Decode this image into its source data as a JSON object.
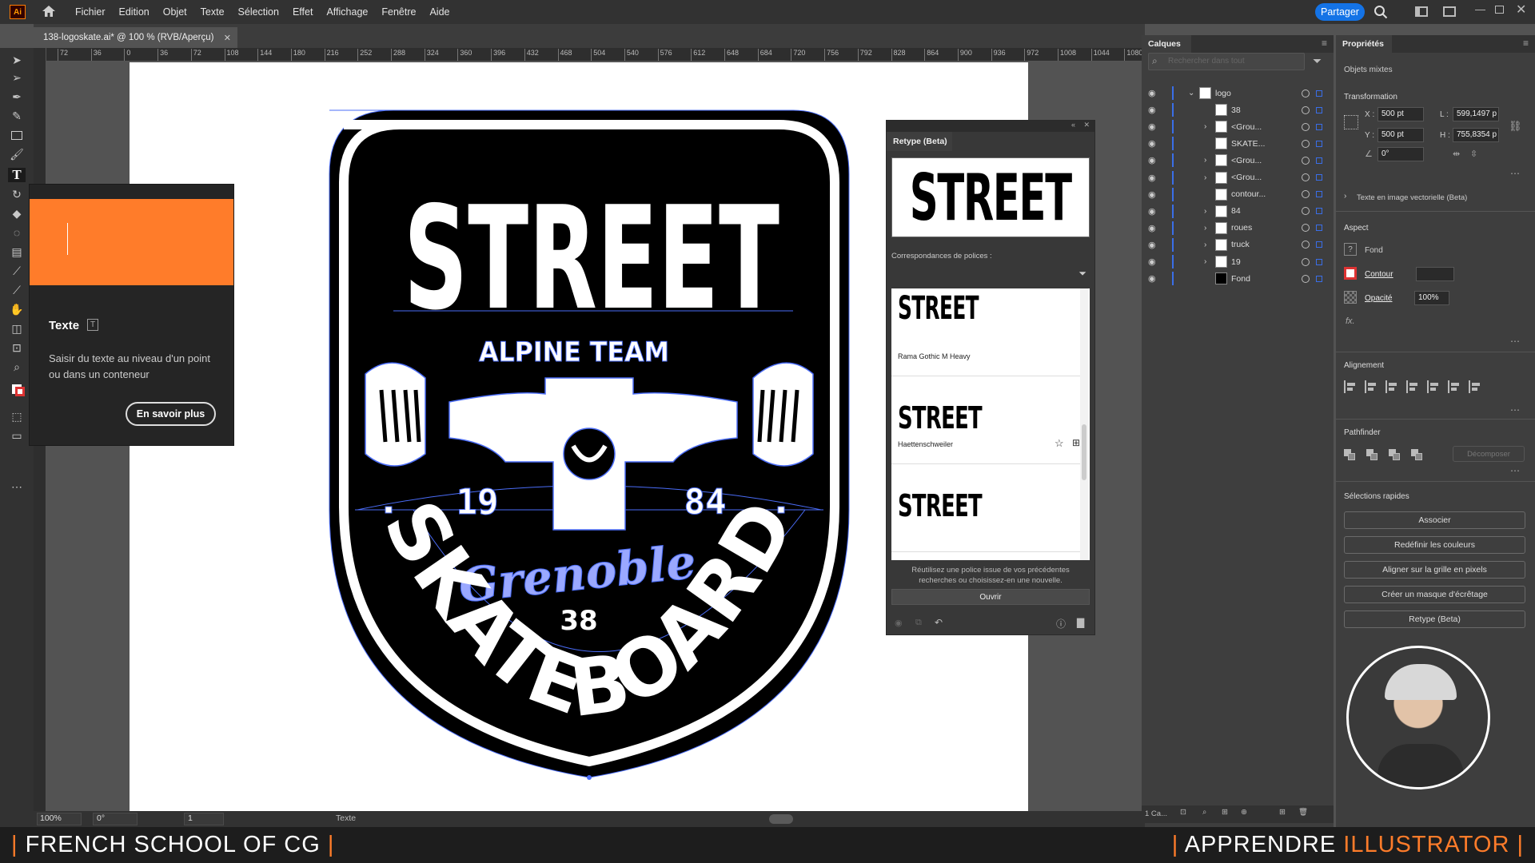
{
  "app": {
    "logo_text": "Ai",
    "share_label": "Partager"
  },
  "menu": [
    "Fichier",
    "Edition",
    "Objet",
    "Texte",
    "Sélection",
    "Effet",
    "Affichage",
    "Fenêtre",
    "Aide"
  ],
  "document": {
    "tab_title": "138-logoskate.ai* @ 100 % (RVB/Aperçu)"
  },
  "ruler": {
    "ticks": [
      "72",
      "36",
      "0",
      "36",
      "72",
      "108",
      "144",
      "180",
      "216",
      "252",
      "288",
      "324",
      "360",
      "396",
      "432",
      "468",
      "504",
      "540",
      "576",
      "612",
      "648",
      "684",
      "720",
      "756",
      "792",
      "828",
      "864",
      "900",
      "936",
      "972",
      "1008",
      "1044",
      "1080"
    ]
  },
  "tooltip": {
    "title": "Texte",
    "shortcut": "T",
    "description": "Saisir du texte au niveau d'un point ou dans un conteneur",
    "learn_more": "En savoir plus"
  },
  "artwork": {
    "title": "STREET",
    "subtitle": "ALPINE TEAM",
    "year_left": "19",
    "year_right": "84",
    "city": "Grenoble",
    "dept": "38",
    "bottom": "SKATEBOARD"
  },
  "retype": {
    "title": "Retype (Beta)",
    "preview_text": "STREET",
    "matches_label": "Correspondances de polices :",
    "fonts": [
      {
        "sample": "STREET",
        "name": ""
      },
      {
        "sample": "STREET",
        "name": "Rama Gothic M Heavy"
      },
      {
        "sample": "STREET",
        "name": "Haettenschweiler"
      }
    ],
    "help_text": "Réutilisez une police issue de vos précédentes recherches ou choisissez-en une nouvelle.",
    "open_button": "Ouvrir"
  },
  "layers": {
    "tab": "Calques",
    "search_placeholder": "Rechercher dans tout",
    "items": [
      {
        "name": "logo",
        "expandable": true,
        "top": true
      },
      {
        "name": "38",
        "expandable": false
      },
      {
        "name": "<Grou...",
        "expandable": true
      },
      {
        "name": "SKATE...",
        "expandable": false
      },
      {
        "name": "<Grou...",
        "expandable": true
      },
      {
        "name": "<Grou...",
        "expandable": true
      },
      {
        "name": "contour...",
        "expandable": false
      },
      {
        "name": "84",
        "expandable": true
      },
      {
        "name": "roues",
        "expandable": true
      },
      {
        "name": "truck",
        "expandable": true
      },
      {
        "name": "19",
        "expandable": true
      },
      {
        "name": "Fond",
        "expandable": false
      }
    ],
    "footer_count": "1 Ca..."
  },
  "properties": {
    "tab": "Propriétés",
    "selection_type": "Objets mixtes",
    "transform_title": "Transformation",
    "x_label": "X :",
    "x_value": "500 pt",
    "y_label": "Y :",
    "y_value": "500 pt",
    "w_label": "L :",
    "w_value": "599,1497 p",
    "h_label": "H :",
    "h_value": "755,8354 p",
    "angle_value": "0°",
    "vector_text": "Texte en image vectorielle (Beta)",
    "aspect_title": "Aspect",
    "fill_label": "Fond",
    "stroke_label": "Contour",
    "opacity_label": "Opacité",
    "opacity_value": "100%",
    "fx_label": "fx.",
    "align_title": "Alignement",
    "pathfinder_title": "Pathfinder",
    "decompose_label": "Décomposer",
    "quick_title": "Sélections rapides",
    "quick_buttons": [
      "Associer",
      "Redéfinir les couleurs",
      "Aligner sur la grille en pixels",
      "Créer un masque d'écrêtage",
      "Retype (Beta)"
    ]
  },
  "status": {
    "zoom": "100%",
    "rotation": "0°",
    "artboard": "1",
    "tool": "Texte"
  },
  "footer": {
    "left": "FRENCH SCHOOL OF CG",
    "right_a": "APPRENDRE ",
    "right_b": "ILLUSTRATOR"
  },
  "colors": {
    "accent": "#ff7c2a",
    "selection": "#4a6cf7",
    "share": "#1473e6"
  }
}
